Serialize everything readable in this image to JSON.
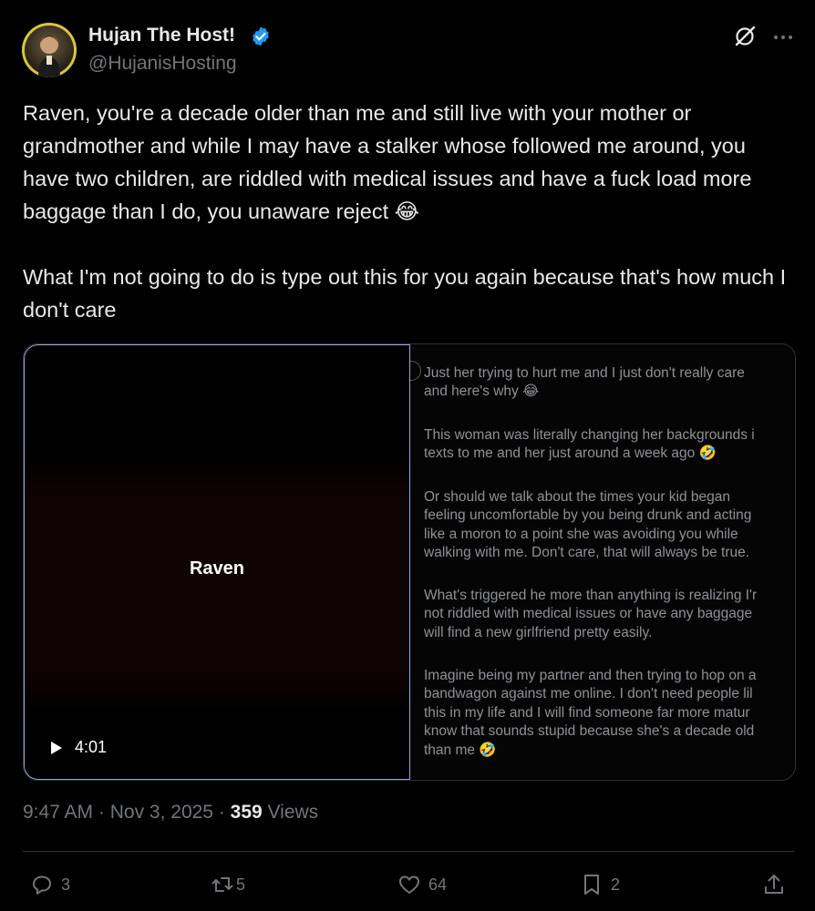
{
  "author": {
    "display_name": "Hujan The Host!",
    "handle": "@HujanisHosting",
    "verified": true
  },
  "post": {
    "text": "Raven, you're a decade older than me and still live with your mother or grandmother and while I may have a stalker whose followed me around, you have two children, are riddled with medical issues and have a fuck load more baggage than I do, you unaware reject 😂\n\nWhat I'm not going to do is type out this for you again because that's how much I don't care"
  },
  "media": {
    "video": {
      "title": "Raven",
      "duration": "4:01"
    },
    "screenshot_messages": [
      [
        "Just her trying to hurt me and I just don't really care",
        "and here's why 😂"
      ],
      [
        "This woman was literally changing her backgrounds i",
        "texts to me and her just around a week ago 🤣"
      ],
      [
        "Or should we talk about the times your kid began",
        "feeling uncomfortable by you being drunk and acting",
        "like a moron to a point she was avoiding you while",
        "walking with me. Don't care, that will always be true."
      ],
      [
        "What's triggered he more than anything is realizing I'r",
        "not riddled with medical issues or have any baggage",
        "will find a new girlfriend pretty easily."
      ],
      [
        "Imagine being my partner and then trying to hop on a",
        "bandwagon against me online. I don't need people lil",
        "this in my life and I will find someone far more matur",
        "know that sounds stupid because she's a decade old",
        "than me 🤣"
      ]
    ]
  },
  "meta": {
    "time": "9:47 AM",
    "date": "Nov 3, 2025",
    "views_count": "359",
    "views_label": "Views"
  },
  "actions": {
    "replies": "3",
    "reposts": "5",
    "likes": "64",
    "bookmarks": "2"
  },
  "colors": {
    "background": "#000000",
    "text": "#e7e9ea",
    "secondary": "#71767b",
    "verified": "#1d9bf0",
    "border": "#2f3336"
  },
  "icons": [
    "verified-badge-icon",
    "grok-icon",
    "more-icon",
    "play-icon",
    "reply-icon",
    "repost-icon",
    "like-icon",
    "bookmark-icon",
    "share-icon"
  ]
}
